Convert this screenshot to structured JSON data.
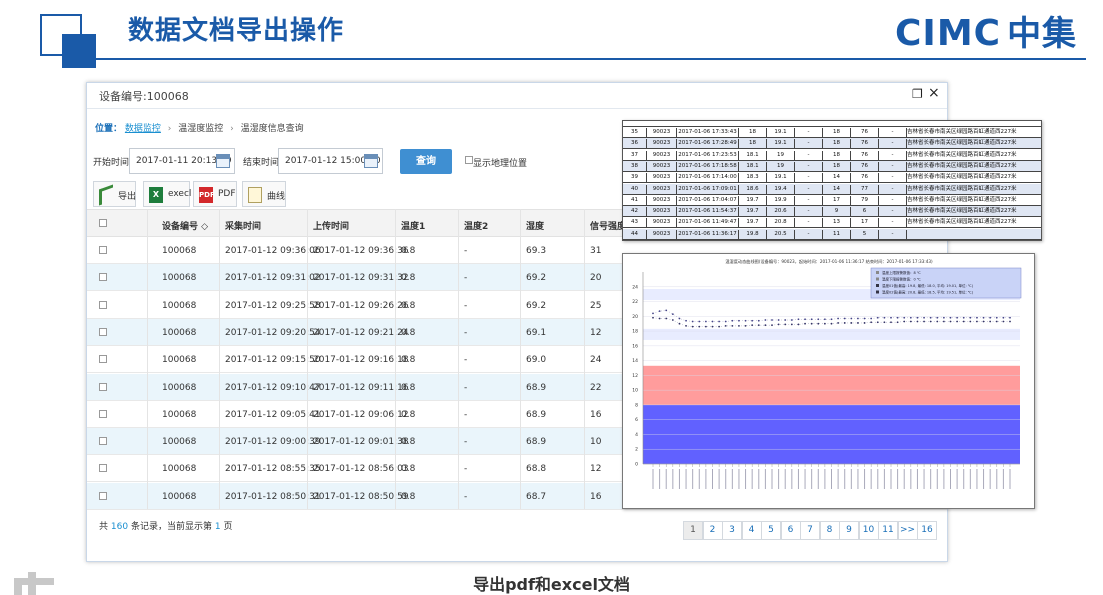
{
  "slide": {
    "title": "数据文档导出操作",
    "logo_latin": "CIMC",
    "logo_cn": "中集",
    "caption": "导出pdf和excel文档"
  },
  "dialog": {
    "title": "设备编号:100068",
    "restore_glyph": "❐",
    "close_glyph": "×",
    "breadcrumb": {
      "label": "位置：",
      "items": [
        "数据监控",
        "温湿度监控",
        "温湿度信息查询"
      ],
      "separator": "›"
    },
    "filters": {
      "start_label": "开始时间",
      "start_value": "2017-01-11 20:13:09",
      "end_label": "结束时间",
      "end_value": "2017-01-12 15:00:00",
      "query_label": "查询",
      "show_geo_label": "显示地理位置"
    },
    "toolbar": {
      "export": "导出",
      "excel": "execl",
      "pdf": "PDF",
      "curve": "曲线",
      "excel_icon": "X",
      "pdf_icon": "PDF"
    },
    "table": {
      "columns": [
        "设备编号 ◇",
        "采集时间",
        "上传时间",
        "温度1",
        "温度2",
        "湿度",
        "信号强度"
      ],
      "rows": [
        [
          "100068",
          "2017-01-12 09:36:06",
          "2017-01-12 09:36:36",
          "0.8",
          "-",
          "69.3",
          "31"
        ],
        [
          "100068",
          "2017-01-12 09:31:02",
          "2017-01-12 09:31:32",
          "0.8",
          "-",
          "69.2",
          "20"
        ],
        [
          "100068",
          "2017-01-12 09:25:58",
          "2017-01-12 09:26:26",
          "0.8",
          "-",
          "69.2",
          "25"
        ],
        [
          "100068",
          "2017-01-12 09:20:54",
          "2017-01-12 09:21:24",
          "0.8",
          "-",
          "69.1",
          "12"
        ],
        [
          "100068",
          "2017-01-12 09:15:50",
          "2017-01-12 09:16:18",
          "0.8",
          "-",
          "69.0",
          "24"
        ],
        [
          "100068",
          "2017-01-12 09:10:47",
          "2017-01-12 09:11:16",
          "0.8",
          "-",
          "68.9",
          "22"
        ],
        [
          "100068",
          "2017-01-12 09:05:41",
          "2017-01-12 09:06:12",
          "0.8",
          "-",
          "68.9",
          "16"
        ],
        [
          "100068",
          "2017-01-12 09:00:39",
          "2017-01-12 09:01:38",
          "0.8",
          "-",
          "68.9",
          "10"
        ],
        [
          "100068",
          "2017-01-12 08:55:35",
          "2017-01-12 08:56:03",
          "0.8",
          "-",
          "68.8",
          "12"
        ],
        [
          "100068",
          "2017-01-12 08:50:31",
          "2017-01-12 08:50:59",
          "0.8",
          "-",
          "68.7",
          "16"
        ]
      ]
    },
    "footer": {
      "prefix": "共",
      "total": "160",
      "middle": "条记录，当前显示第",
      "page": "1",
      "suffix": "页"
    },
    "pager": [
      "1",
      "2",
      "3",
      "4",
      "5",
      "6",
      "7",
      "8",
      "9",
      "10",
      "11",
      ">>",
      "16"
    ]
  },
  "export_table": {
    "rows": [
      [
        "35",
        "90023",
        "2017-01-06 17:33:43",
        "18",
        "19.1",
        "-",
        "18",
        "76",
        "-",
        "吉林省长春市南关区绿园路百虹通道西227米"
      ],
      [
        "36",
        "90023",
        "2017-01-06 17:28:49",
        "18",
        "19.1",
        "-",
        "18",
        "76",
        "-",
        "吉林省长春市南关区绿园路百虹通道西227米"
      ],
      [
        "37",
        "90023",
        "2017-01-06 17:23:53",
        "18.1",
        "19",
        "-",
        "18",
        "76",
        "-",
        "吉林省长春市南关区绿园路百虹通道西227米"
      ],
      [
        "38",
        "90023",
        "2017-01-06 17:18:58",
        "18.1",
        "19",
        "-",
        "18",
        "76",
        "-",
        "吉林省长春市南关区绿园路百虹通道西227米"
      ],
      [
        "39",
        "90023",
        "2017-01-06 17:14:00",
        "18.3",
        "19.1",
        "-",
        "14",
        "76",
        "-",
        "吉林省长春市南关区绿园路百虹通道西227米"
      ],
      [
        "40",
        "90023",
        "2017-01-06 17:09:01",
        "18.6",
        "19.4",
        "-",
        "14",
        "77",
        "-",
        "吉林省长春市南关区绿园路百虹通道西227米"
      ],
      [
        "41",
        "90023",
        "2017-01-06 17:04:07",
        "19.7",
        "19.9",
        "-",
        "17",
        "79",
        "-",
        "吉林省长春市南关区绿园路百虹通道西227米"
      ],
      [
        "42",
        "90023",
        "2017-01-06 11:54:37",
        "19.7",
        "20.6",
        "-",
        "9",
        "6",
        "-",
        "吉林省长春市南关区绿园路百虹通道西227米"
      ],
      [
        "43",
        "90023",
        "2017-01-06 11:49:47",
        "19.7",
        "20.8",
        "-",
        "13",
        "17",
        "-",
        "吉林省长春市南关区绿园路百虹通道西227米"
      ],
      [
        "44",
        "90023",
        "2017-01-06 11:36:17",
        "19.8",
        "20.5",
        "-",
        "11",
        "5",
        "-",
        ""
      ]
    ]
  },
  "chart_data": {
    "type": "line",
    "title": "温湿度动态曲线图(设备编号：90023，起始时间：2017-01-06 11:36:17  结束时间：2017-01-06 17:33:43)",
    "ylim": [
      0,
      26
    ],
    "yticks": [
      0,
      2,
      4,
      6,
      8,
      10,
      12,
      14,
      16,
      18,
      20,
      22,
      24
    ],
    "bands": [
      {
        "from": 0,
        "to": 8,
        "color": "#6161ff"
      },
      {
        "from": 8,
        "to": 13.3,
        "color": "#ff9c9c"
      },
      {
        "from": 16.8,
        "to": 18.3,
        "color": "#e8ecff"
      },
      {
        "from": 22.2,
        "to": 23.7,
        "color": "#e8ecff"
      }
    ],
    "legend": [
      "温度上限报警数值：8 ℃",
      "温度下限报警数值：0 ℃",
      "温度01值(最高: 19.8, 最低: 18.0, 平均: 19.01, 单位: ℃)",
      "温度02值(最高: 20.8, 最低: 18.5, 平均: 19.51, 单位: ℃)"
    ],
    "legend_placement": "top-right",
    "series": [
      {
        "name": "温度01值",
        "color": "#333366",
        "values": [
          19.8,
          19.7,
          19.7,
          19.5,
          19.0,
          18.7,
          18.6,
          18.6,
          18.6,
          18.6,
          18.6,
          18.7,
          18.7,
          18.7,
          18.7,
          18.8,
          18.8,
          18.8,
          18.8,
          18.9,
          18.9,
          18.9,
          18.9,
          19.0,
          19.0,
          19.0,
          19.0,
          19.0,
          19.1,
          19.1,
          19.1,
          19.1,
          19.1,
          19.2,
          19.2,
          19.2,
          19.2,
          19.2,
          19.3,
          19.3,
          19.3,
          19.3,
          19.3,
          19.3,
          19.3,
          19.3,
          19.3,
          19.3,
          19.3,
          19.3,
          19.3,
          19.3,
          19.3,
          19.3,
          19.3
        ]
      },
      {
        "name": "温度02值",
        "color": "#444488",
        "values": [
          20.4,
          20.7,
          20.8,
          20.3,
          19.7,
          19.4,
          19.3,
          19.3,
          19.3,
          19.3,
          19.3,
          19.3,
          19.4,
          19.4,
          19.4,
          19.4,
          19.4,
          19.5,
          19.5,
          19.5,
          19.5,
          19.5,
          19.6,
          19.6,
          19.6,
          19.6,
          19.6,
          19.6,
          19.7,
          19.7,
          19.7,
          19.7,
          19.7,
          19.7,
          19.8,
          19.8,
          19.8,
          19.8,
          19.8,
          19.8,
          19.8,
          19.8,
          19.8,
          19.8,
          19.8,
          19.8,
          19.8,
          19.8,
          19.8,
          19.8,
          19.8,
          19.8,
          19.8,
          19.8,
          19.8
        ]
      }
    ]
  }
}
